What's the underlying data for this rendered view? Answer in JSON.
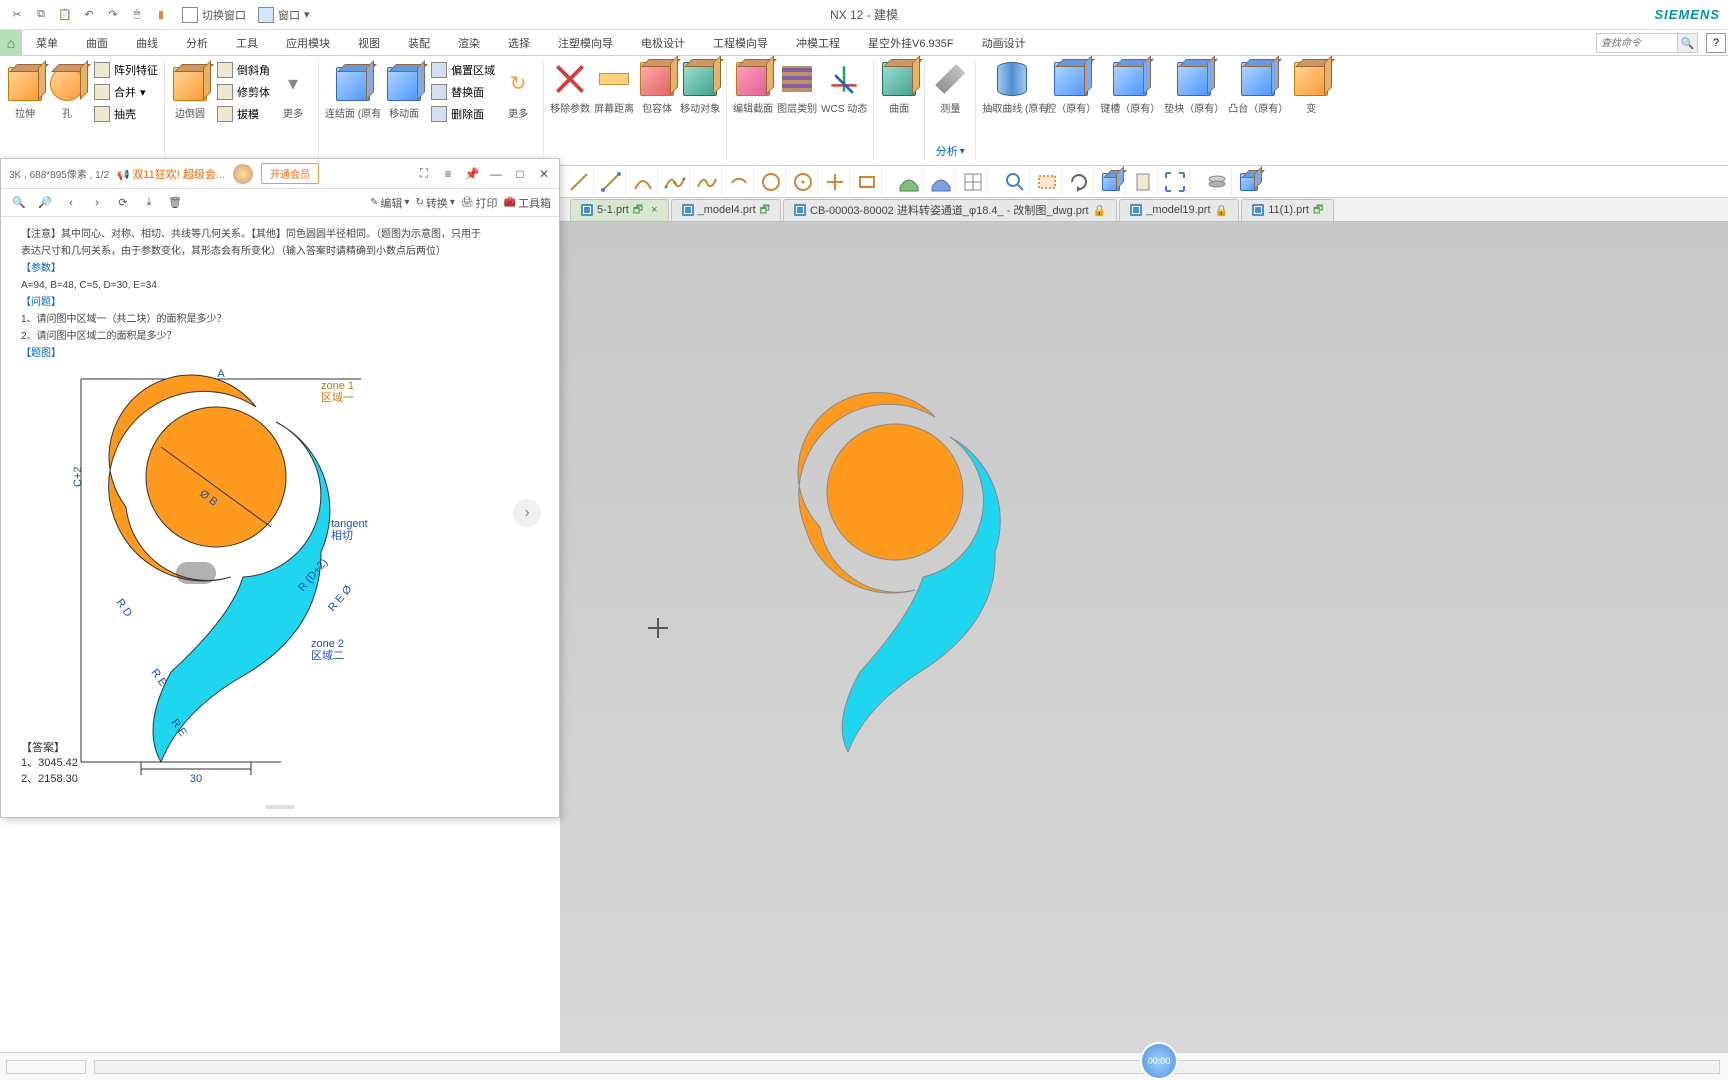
{
  "title_bar": {
    "app_title": "NX 12 - 建模",
    "brand": "SIEMENS",
    "switch_window": "切换窗口",
    "window_btn": "窗口"
  },
  "menu": [
    "菜单",
    "曲面",
    "曲线",
    "分析",
    "工具",
    "应用模块",
    "视图",
    "装配",
    "渲染",
    "选择",
    "注塑模向导",
    "电极设计",
    "工程模向导",
    "冲模工程",
    "星空外挂V6.935F",
    "动画设计"
  ],
  "search_placeholder": "查找命令",
  "ribbon": {
    "g1": {
      "btn1": "拉伸",
      "btn2": "孔",
      "r1": "阵列特征",
      "r2": "合并",
      "r3": "抽壳"
    },
    "g2": {
      "big": "边倒圆",
      "r1": "倒斜角",
      "r2": "修剪体",
      "r3": "拔模",
      "more": "更多"
    },
    "g3": {
      "b1": "连结面 (原有",
      "b2": "移动面",
      "more": "更多",
      "r1": "偏置区域",
      "r2": "替换面",
      "r3": "删除面"
    },
    "g4": {
      "b1": "移除参数",
      "b2": "屏幕距离",
      "b3": "包容体",
      "b4": "移动对象"
    },
    "g5": {
      "b1": "编辑截面",
      "b2": "图层类别",
      "b3": "WCS 动态"
    },
    "g6": {
      "b1": "曲面"
    },
    "g7": {
      "b1": "测量",
      "foot": "分析"
    },
    "g8": {
      "b1": "抽取曲线 (原有",
      "b2": "腔（原有）",
      "b3": "键槽（原有）",
      "b4": "垫块（原有）",
      "b5": "凸台（原有）",
      "b6": "变"
    }
  },
  "part_tabs": [
    {
      "name": "5-1.prt",
      "active": true,
      "mod": true
    },
    {
      "name": "_model4.prt",
      "active": false,
      "mod": true
    },
    {
      "name": "CB-00003-80002 进料转姿通道_φ18.4_ - 改制图_dwg.prt",
      "active": false,
      "lock": true
    },
    {
      "name": "_model19.prt",
      "active": false,
      "lock": true
    },
    {
      "name": "11(1).prt",
      "active": false,
      "mod": true
    }
  ],
  "ref": {
    "hdr_left": "3K , 688*895像素 , 1/2",
    "promo": "双11狂欢! 超级会...",
    "vip": "开通会员",
    "tb": {
      "edit": "编辑",
      "rotate": "转换",
      "print": "打印",
      "toolbox": "工具箱"
    },
    "body": {
      "note1": "【注意】其中同心、对称、相切、共线等几何关系。【其他】同色圆圆半径相同。（题图为示意图，只用于",
      "note2": "表达尺寸和几何关系，由于参数变化，其形态会有所变化）（输入答案时请精确到小数点后两位）",
      "params_title": "【参数】",
      "params": "A=94,  B=48,  C=5,  D=30,  E=34",
      "q_title": "【问题】",
      "q1": "1、请问图中区域一（共二块）的面积是多少？",
      "q2": "2、请问图中区域二的面积是多少？",
      "fig_title": "【题图】",
      "ans_title": "【答案】",
      "ans1": "1、3045.42",
      "ans2": "2、2158.30",
      "zone1_label": "zone 1",
      "zone1_cn": "区域一",
      "zone2_label": "zone 2",
      "zone2_cn": "区域二",
      "tangent_en": "tangent",
      "tangent_cn": "相切",
      "dim_A": "A",
      "dim_30": "30"
    }
  },
  "timer": "00:00"
}
